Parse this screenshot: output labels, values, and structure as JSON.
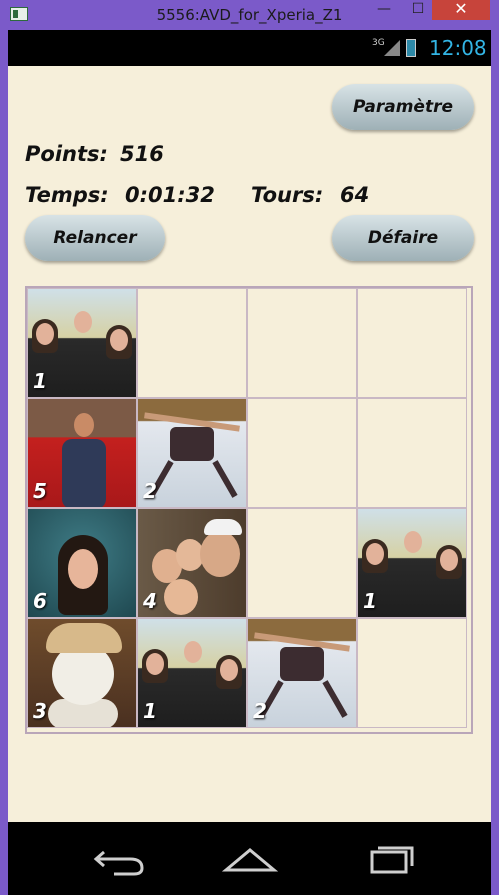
{
  "window": {
    "title": "5556:AVD_for_Xperia_Z1",
    "min_glyph": "—",
    "max_glyph": "☐",
    "close_glyph": "✕"
  },
  "status": {
    "network": "3G",
    "time": "12:08"
  },
  "game": {
    "points_label": "Points:",
    "points_value": "516",
    "time_label": "Temps:",
    "time_value": "0:01:32",
    "turns_label": "Tours:",
    "turns_value": "64",
    "settings_button": "Paramètre",
    "restart_button": "Relancer",
    "undo_button": "Défaire"
  },
  "board": {
    "cells": [
      {
        "id": "r0c0",
        "photo": "family",
        "count": "1"
      },
      {
        "id": "r0c1",
        "photo": "empty",
        "count": ""
      },
      {
        "id": "r0c2",
        "photo": "empty",
        "count": ""
      },
      {
        "id": "r0c3",
        "photo": "empty",
        "count": ""
      },
      {
        "id": "r1c0",
        "photo": "girl-red-chair",
        "count": "5"
      },
      {
        "id": "r1c1",
        "photo": "snow-angel",
        "count": "2"
      },
      {
        "id": "r1c2",
        "photo": "empty",
        "count": ""
      },
      {
        "id": "r1c3",
        "photo": "empty",
        "count": ""
      },
      {
        "id": "r2c0",
        "photo": "painting",
        "count": "6"
      },
      {
        "id": "r2c1",
        "photo": "selfie",
        "count": "4"
      },
      {
        "id": "r2c2",
        "photo": "empty",
        "count": ""
      },
      {
        "id": "r2c3",
        "photo": "family",
        "count": "1"
      },
      {
        "id": "r3c0",
        "photo": "sheep-toy",
        "count": "3"
      },
      {
        "id": "r3c1",
        "photo": "family",
        "count": "1"
      },
      {
        "id": "r3c2",
        "photo": "snow-angel",
        "count": "2"
      },
      {
        "id": "r3c3",
        "photo": "empty",
        "count": ""
      }
    ]
  },
  "colors": {
    "app_bg": "#f6efda",
    "accent": "#33b5e5",
    "window_frame": "#7b5ac9",
    "close": "#c7443b"
  },
  "nav": {
    "back_icon": "back-icon",
    "home_icon": "home-icon",
    "recent_icon": "recent-apps-icon"
  }
}
